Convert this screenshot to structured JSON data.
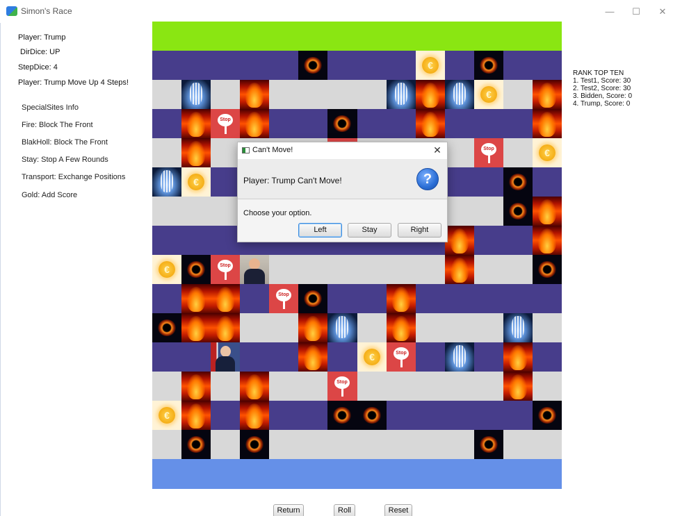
{
  "window": {
    "title": "Simon's Race",
    "controls": {
      "minimize": "—",
      "maximize": "☐",
      "close": "✕"
    }
  },
  "status": {
    "player": "Player: Trump",
    "dir_dice": "DirDice: UP",
    "step_dice": "StepDice: 4",
    "message": "Player: Trump Move Up 4 Steps!"
  },
  "special_sites": {
    "title": "SpecialSites Info",
    "items": [
      "Fire: Block The Front",
      "BlakHoll: Block The Front",
      "Stay: Stop A Few Rounds",
      "Transport: Exchange Positions",
      "Gold: Add Score"
    ]
  },
  "rank": {
    "title": "RANK TOP TEN",
    "entries": [
      "1. Test1, Score: 30",
      "2. Test2, Score: 30",
      "3. Bidden, Score: 0",
      "4. Trump, Score: 0"
    ]
  },
  "board": {
    "top_color": "#8ae612",
    "bottom_color": "#6590e8",
    "rows": [
      [
        "p",
        "p",
        "p",
        "p",
        "p",
        "hole",
        "p",
        "p",
        "p",
        "gold",
        "p",
        "hole",
        "p",
        "p"
      ],
      [
        "g",
        "portal",
        "g",
        "fire",
        "g",
        "g",
        "g",
        "g",
        "portal",
        "fire",
        "portal",
        "gold",
        "g",
        "fire"
      ],
      [
        "p",
        "fire",
        "stop",
        "fire",
        "p",
        "p",
        "hole",
        "p",
        "p",
        "fire",
        "p",
        "p",
        "p",
        "fire"
      ],
      [
        "g",
        "fire",
        "g",
        "g",
        "g",
        "g",
        "stop",
        "g",
        "g",
        "g",
        "g",
        "stop",
        "g",
        "gold"
      ],
      [
        "portal",
        "gold",
        "p",
        "p",
        "p",
        "p",
        "p",
        "p",
        "p",
        "p",
        "p",
        "p",
        "hole",
        "p"
      ],
      [
        "g",
        "g",
        "g",
        "g",
        "g",
        "g",
        "g",
        "g",
        "g",
        "g",
        "g",
        "g",
        "hole",
        "fire"
      ],
      [
        "p",
        "p",
        "p",
        "p",
        "p",
        "p",
        "p",
        "p",
        "p",
        "p",
        "fire",
        "p",
        "p",
        "fire"
      ],
      [
        "gold",
        "hole",
        "stop",
        "trump",
        "g",
        "g",
        "g",
        "g",
        "g",
        "g",
        "fire",
        "g",
        "g",
        "hole"
      ],
      [
        "p",
        "fire",
        "fire",
        "p",
        "stop",
        "hole",
        "p",
        "p",
        "fire",
        "p",
        "p",
        "p",
        "p",
        "p"
      ],
      [
        "hole",
        "fire",
        "fire",
        "g",
        "g",
        "fire",
        "portal",
        "g",
        "fire",
        "g",
        "g",
        "g",
        "portal",
        "g"
      ],
      [
        "p",
        "p",
        "biden",
        "p",
        "p",
        "fire",
        "p",
        "gold",
        "stop",
        "p",
        "portal",
        "p",
        "fire",
        "p"
      ],
      [
        "g",
        "fire",
        "g",
        "fire",
        "g",
        "g",
        "stop",
        "g",
        "g",
        "g",
        "g",
        "g",
        "fire",
        "g"
      ],
      [
        "gold",
        "fire",
        "p",
        "fire",
        "p",
        "p",
        "hole",
        "hole",
        "p",
        "p",
        "p",
        "p",
        "p",
        "hole"
      ],
      [
        "g",
        "hole",
        "g",
        "hole",
        "g",
        "g",
        "g",
        "g",
        "g",
        "g",
        "g",
        "hole",
        "g",
        "g"
      ]
    ]
  },
  "dialog": {
    "title": "Can't Move!",
    "message": "Player: Trump Can't Move!",
    "prompt": "Choose your option.",
    "close": "✕",
    "icon_glyph": "?",
    "buttons": {
      "left": "Left",
      "stay": "Stay",
      "right": "Right"
    }
  },
  "controls": {
    "return": "Return",
    "roll": "Roll",
    "reset": "Reset"
  }
}
